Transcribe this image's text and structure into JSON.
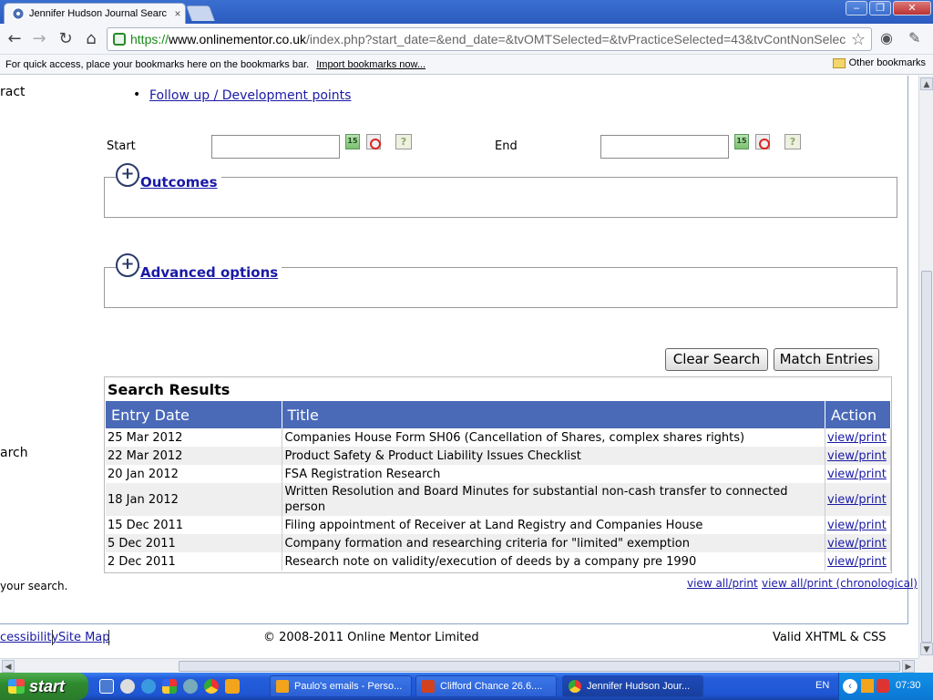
{
  "browser": {
    "tab_title": "Jennifer Hudson Journal Searc",
    "tab_close": "×",
    "url_https": "https://",
    "url_domain": "www.onlinementor.co.uk",
    "url_rest": "/index.php?start_date=&end_date=&tvOMTSelected=&tvPracticeSelected=43&tvContNonSelec",
    "bookmarks_hint": "For quick access, place your bookmarks here on the bookmarks bar.",
    "bookmarks_import": "Import bookmarks now...",
    "other_bookmarks": "Other bookmarks",
    "win_minimize": "–",
    "win_maximize": "❐",
    "win_close": "✕"
  },
  "sidebar": {
    "fragment_1": "ract",
    "fragment_2": "arch",
    "fragment_3": "your search."
  },
  "search": {
    "followup_link": "Follow up / Development points",
    "start_label": "Start",
    "end_label": "End",
    "start_value": "",
    "end_value": "",
    "cal_icon_text": "15",
    "help_icon_text": "?",
    "outcomes_label": "Outcomes",
    "advanced_label": "Advanced options",
    "clear_button": "Clear Search",
    "match_button": "Match Entries"
  },
  "results": {
    "heading": "Search Results",
    "columns": [
      "Entry Date",
      "Title",
      "Action"
    ],
    "rows": [
      {
        "date": "25 Mar 2012",
        "title": "Companies House Form SH06 (Cancellation of Shares, complex shares rights)",
        "action": "view/print"
      },
      {
        "date": "22 Mar 2012",
        "title": "Product Safety & Product Liability Issues Checklist",
        "action": "view/print"
      },
      {
        "date": "20 Jan 2012",
        "title": "FSA Registration Research",
        "action": "view/print"
      },
      {
        "date": "18 Jan 2012",
        "title": "Written Resolution and Board Minutes for substantial non-cash transfer to connected person",
        "action": "view/print"
      },
      {
        "date": "15 Dec 2011",
        "title": "Filing appointment of Receiver at Land Registry and Companies House",
        "action": "view/print"
      },
      {
        "date": "5 Dec 2011",
        "title": "Company formation and researching criteria for \"limited\" exemption",
        "action": "view/print"
      },
      {
        "date": "2 Dec 2011",
        "title": "Research note on validity/execution of deeds by a company pre 1990",
        "action": "view/print"
      }
    ],
    "view_all": "view all/print",
    "view_all_chrono": "view all/print (chronological)"
  },
  "footer": {
    "accessibility": "cessibility",
    "sitemap": "Site Map",
    "copyright": "© 2008-2011 Online Mentor Limited",
    "valid": "Valid XHTML & CSS"
  },
  "taskbar": {
    "start": "start",
    "tasks": [
      "Paulo's emails - Perso...",
      "Clifford Chance 26.6....",
      "Jennifer Hudson Jour..."
    ],
    "lang": "EN",
    "clock": "07:30"
  }
}
